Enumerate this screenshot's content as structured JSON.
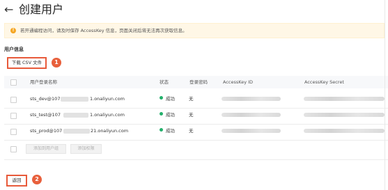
{
  "header": {
    "back_icon": "arrow-left-icon",
    "title": "创建用户"
  },
  "banner": {
    "text": "若开通编程访问，请及时保存 AccessKey 信息，页面关闭后将无法再次获取信息。",
    "icon": "warning-icon"
  },
  "section": {
    "title": "用户信息"
  },
  "download": {
    "label": "下载 CSV 文件",
    "callout": "1"
  },
  "table": {
    "columns": [
      "用户登录名称",
      "状态",
      "登录密码",
      "AccessKey ID",
      "AccessKey Secret"
    ],
    "rows": [
      {
        "login_prefix": "sts_dev@107",
        "login_suffix": "1.onaliyun.com",
        "status": "成功",
        "password": "无"
      },
      {
        "login_prefix": "sts_test@107",
        "login_suffix": "1.onaliyun.com",
        "status": "成功",
        "password": "无"
      },
      {
        "login_prefix": "sts_prod@107",
        "login_suffix": "21.onaliyun.com",
        "status": "成功",
        "password": "无"
      }
    ],
    "footer_buttons": [
      "添加到用户组",
      "添加权限"
    ]
  },
  "return": {
    "label": "返回",
    "callout": "2"
  },
  "colors": {
    "accent_border": "#e85a3a",
    "callout": "#e8603c",
    "success": "#23b06b",
    "banner_bg": "#fff7e6"
  }
}
